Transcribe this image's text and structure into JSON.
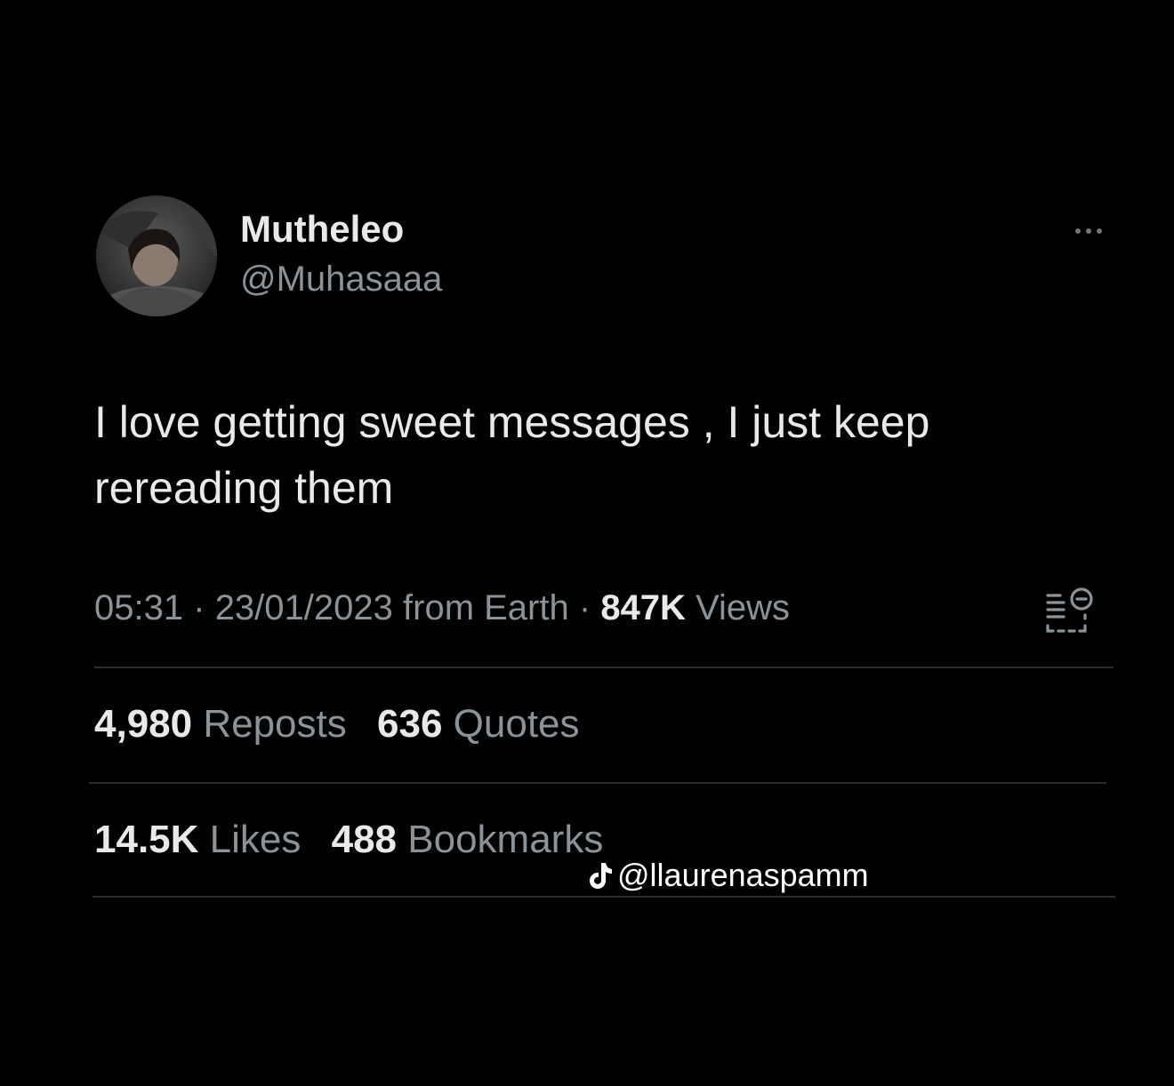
{
  "user": {
    "display_name": "Mutheleo",
    "handle": "@Muhasaaa",
    "avatar_icon": "profile-photo"
  },
  "tweet": {
    "text": "I love getting sweet messages , I just keep rereading them",
    "time": "05:31",
    "date": "23/01/2023",
    "source": "from Earth",
    "separator": "·",
    "views_count": "847K",
    "views_label": "Views"
  },
  "stats": {
    "reposts_count": "4,980",
    "reposts_label": "Reposts",
    "quotes_count": "636",
    "quotes_label": "Quotes",
    "likes_count": "14.5K",
    "likes_label": "Likes",
    "bookmarks_count": "488",
    "bookmarks_label": "Bookmarks"
  },
  "watermark": {
    "icon": "tiktok-icon",
    "text": "@llaurenaspamm"
  },
  "icons": {
    "more": "more-dots-icon",
    "analytics": "analytics-icon"
  },
  "colors": {
    "background": "#000000",
    "primary_text": "#e7e9ea",
    "secondary_text": "#8b9298",
    "divider": "#2a2d30"
  }
}
